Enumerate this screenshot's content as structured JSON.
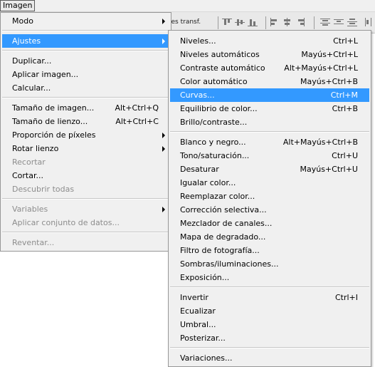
{
  "menubar": {
    "imagen": "Imagen"
  },
  "toolbar": {
    "transform_label": "les transf."
  },
  "menu": {
    "groups": [
      [
        {
          "label": "Modo",
          "submenu": true
        }
      ],
      [
        {
          "label": "Ajustes",
          "submenu": true,
          "highlighted": true
        }
      ],
      [
        {
          "label": "Duplicar..."
        },
        {
          "label": "Aplicar imagen..."
        },
        {
          "label": "Calcular..."
        }
      ],
      [
        {
          "label": "Tamaño de imagen...",
          "shortcut": "Alt+Ctrl+Q"
        },
        {
          "label": "Tamaño de lienzo...",
          "shortcut": "Alt+Ctrl+C"
        },
        {
          "label": "Proporción de píxeles",
          "submenu": true
        },
        {
          "label": "Rotar lienzo",
          "submenu": true
        },
        {
          "label": "Recortar",
          "disabled": true
        },
        {
          "label": "Cortar..."
        },
        {
          "label": "Descubrir todas",
          "disabled": true
        }
      ],
      [
        {
          "label": "Variables",
          "submenu": true,
          "disabled": true
        },
        {
          "label": "Aplicar conjunto de datos...",
          "disabled": true
        }
      ],
      [
        {
          "label": "Reventar...",
          "disabled": true
        }
      ]
    ]
  },
  "submenu": {
    "groups": [
      [
        {
          "label": "Niveles...",
          "shortcut": "Ctrl+L"
        },
        {
          "label": "Niveles automáticos",
          "shortcut": "Mayús+Ctrl+L"
        },
        {
          "label": "Contraste automático",
          "shortcut": "Alt+Mayús+Ctrl+L"
        },
        {
          "label": "Color automático",
          "shortcut": "Mayús+Ctrl+B"
        },
        {
          "label": "Curvas...",
          "shortcut": "Ctrl+M",
          "highlighted": true
        },
        {
          "label": "Equilibrio de color...",
          "shortcut": "Ctrl+B"
        },
        {
          "label": "Brillo/contraste..."
        }
      ],
      [
        {
          "label": "Blanco y negro...",
          "shortcut": "Alt+Mayús+Ctrl+B"
        },
        {
          "label": "Tono/saturación...",
          "shortcut": "Ctrl+U"
        },
        {
          "label": "Desaturar",
          "shortcut": "Mayús+Ctrl+U"
        },
        {
          "label": "Igualar color..."
        },
        {
          "label": "Reemplazar color..."
        },
        {
          "label": "Corrección selectiva..."
        },
        {
          "label": "Mezclador de canales..."
        },
        {
          "label": "Mapa de degradado..."
        },
        {
          "label": "Filtro de fotografía..."
        },
        {
          "label": "Sombras/iluminaciones..."
        },
        {
          "label": "Exposición..."
        }
      ],
      [
        {
          "label": "Invertir",
          "shortcut": "Ctrl+I"
        },
        {
          "label": "Ecualizar"
        },
        {
          "label": "Umbral..."
        },
        {
          "label": "Posterizar..."
        }
      ],
      [
        {
          "label": "Variaciones..."
        }
      ]
    ]
  },
  "colors": {
    "highlight": "#3399ff",
    "menu_bg": "#f0f0f0",
    "disabled": "#8d8d8d"
  }
}
